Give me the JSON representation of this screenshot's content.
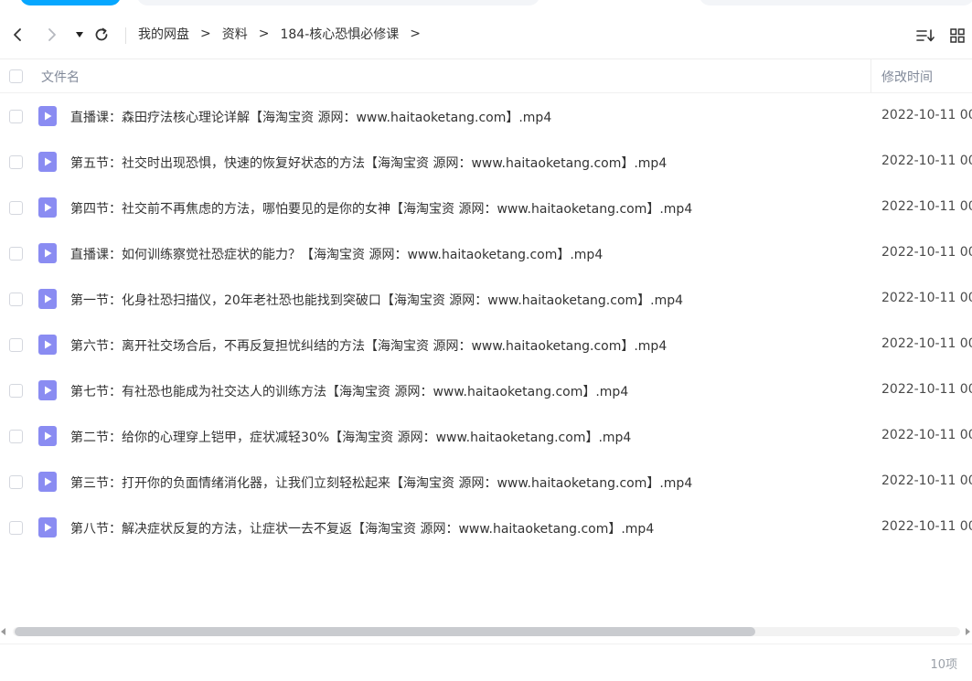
{
  "nav": {
    "back_icon": "chevron-left-icon",
    "forward_icon": "chevron-right-icon",
    "dropdown_icon": "caret-down-icon",
    "refresh_icon": "refresh-icon",
    "breadcrumb": [
      "我的网盘",
      "资料",
      "184-核心恐惧必修课"
    ],
    "crumb_sep": ">",
    "sort_icon": "sort-list-icon",
    "grid_icon": "grid-view-icon"
  },
  "table": {
    "col_name": "文件名",
    "col_time": "修改时间",
    "rows": [
      {
        "name": "直播课：森田疗法核心理论详解【海淘宝资 源网：www.haitaoketang.com】.mp4",
        "time": "2022-10-11 00"
      },
      {
        "name": "第五节：社交时出现恐惧，快速的恢复好状态的方法【海淘宝资 源网：www.haitaoketang.com】.mp4",
        "time": "2022-10-11 00"
      },
      {
        "name": "第四节：社交前不再焦虑的方法，哪怕要见的是你的女神【海淘宝资 源网：www.haitaoketang.com】.mp4",
        "time": "2022-10-11 00"
      },
      {
        "name": "直播课：如何训练察觉社恐症状的能力？【海淘宝资 源网：www.haitaoketang.com】.mp4",
        "time": "2022-10-11 00"
      },
      {
        "name": "第一节：化身社恐扫描仪，20年老社恐也能找到突破口【海淘宝资 源网：www.haitaoketang.com】.mp4",
        "time": "2022-10-11 00"
      },
      {
        "name": "第六节：离开社交场合后，不再反复担忧纠结的方法【海淘宝资 源网：www.haitaoketang.com】.mp4",
        "time": "2022-10-11 00"
      },
      {
        "name": "第七节：有社恐也能成为社交达人的训练方法【海淘宝资 源网：www.haitaoketang.com】.mp4",
        "time": "2022-10-11 00"
      },
      {
        "name": "第二节：给你的心理穿上铠甲，症状减轻30%【海淘宝资 源网：www.haitaoketang.com】.mp4",
        "time": "2022-10-11 00"
      },
      {
        "name": "第三节：打开你的负面情绪消化器，让我们立刻轻松起来【海淘宝资 源网：www.haitaoketang.com】.mp4",
        "time": "2022-10-11 00"
      },
      {
        "name": "第八节：解决症状反复的方法，让症状一去不复返【海淘宝资 源网：www.haitaoketang.com】.mp4",
        "time": "2022-10-11 00"
      }
    ]
  },
  "file_icon": "video-file-icon",
  "colors": {
    "accent": "#06a7ff",
    "video_icon": "#8a8cf2"
  },
  "footer": {
    "count": "10项"
  }
}
